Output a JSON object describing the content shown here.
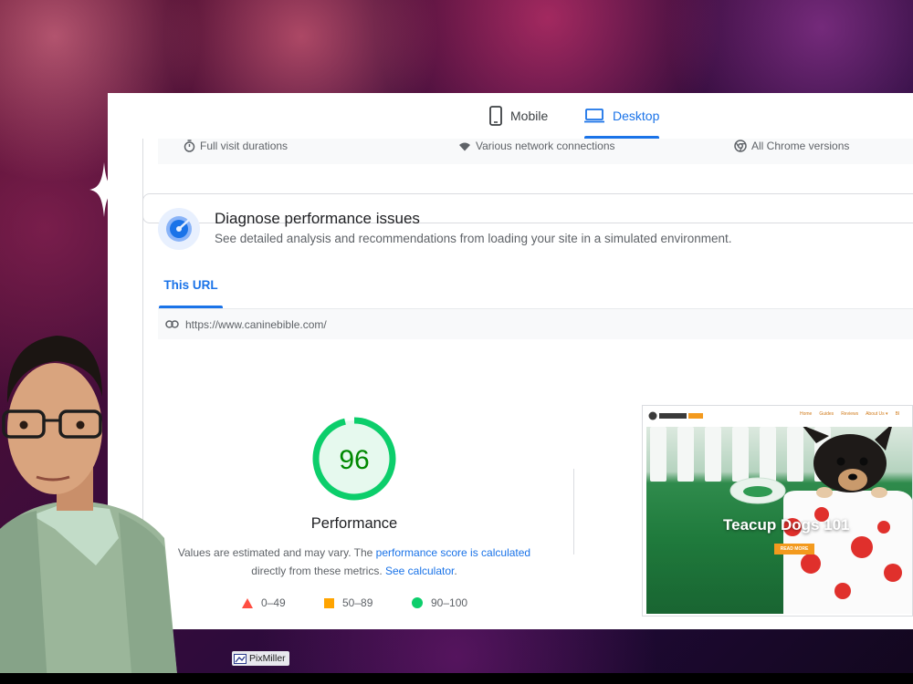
{
  "device_tabs": [
    {
      "label": "Mobile",
      "icon": "phone-icon",
      "selected": false
    },
    {
      "label": "Desktop",
      "icon": "laptop-icon",
      "selected": true
    }
  ],
  "field_features": [
    {
      "icon": "stopwatch-icon",
      "label": "Full visit durations"
    },
    {
      "icon": "wifi-icon",
      "label": "Various network connections"
    },
    {
      "icon": "chrome-icon",
      "label": "All Chrome versions"
    }
  ],
  "diagnose": {
    "title": "Diagnose performance issues",
    "subtitle": "See detailed analysis and recommendations from loading your site in a simulated environment."
  },
  "url_tab": "This URL",
  "url": "https://www.caninebible.com/",
  "performance": {
    "score": "96",
    "score_fraction": 0.96,
    "score_color": "#0cce6b",
    "label": "Performance",
    "note_text_1": "Values are estimated and may vary. The ",
    "note_link_1": "performance score is calculated",
    "note_text_2": "directly from these metrics. ",
    "note_link_2": "See calculator",
    "note_text_3": "."
  },
  "legend": [
    {
      "shape": "triangle",
      "color": "#ff4e42",
      "range": "0–49"
    },
    {
      "shape": "square",
      "color": "#ffa400",
      "range": "50–89"
    },
    {
      "shape": "circle",
      "color": "#0cce6b",
      "range": "90–100"
    }
  ],
  "preview": {
    "nav_links": [
      "Home",
      "Guides",
      "Reviews",
      "About Us ▾",
      "Bl"
    ],
    "hero_title": "Teacup Dogs 101",
    "hero_button": "READ MORE"
  },
  "watermark": "PixMiller",
  "colors": {
    "accent": "#1a73e8",
    "pass": "#0cce6b",
    "average": "#ffa400",
    "fail": "#ff4e42"
  }
}
